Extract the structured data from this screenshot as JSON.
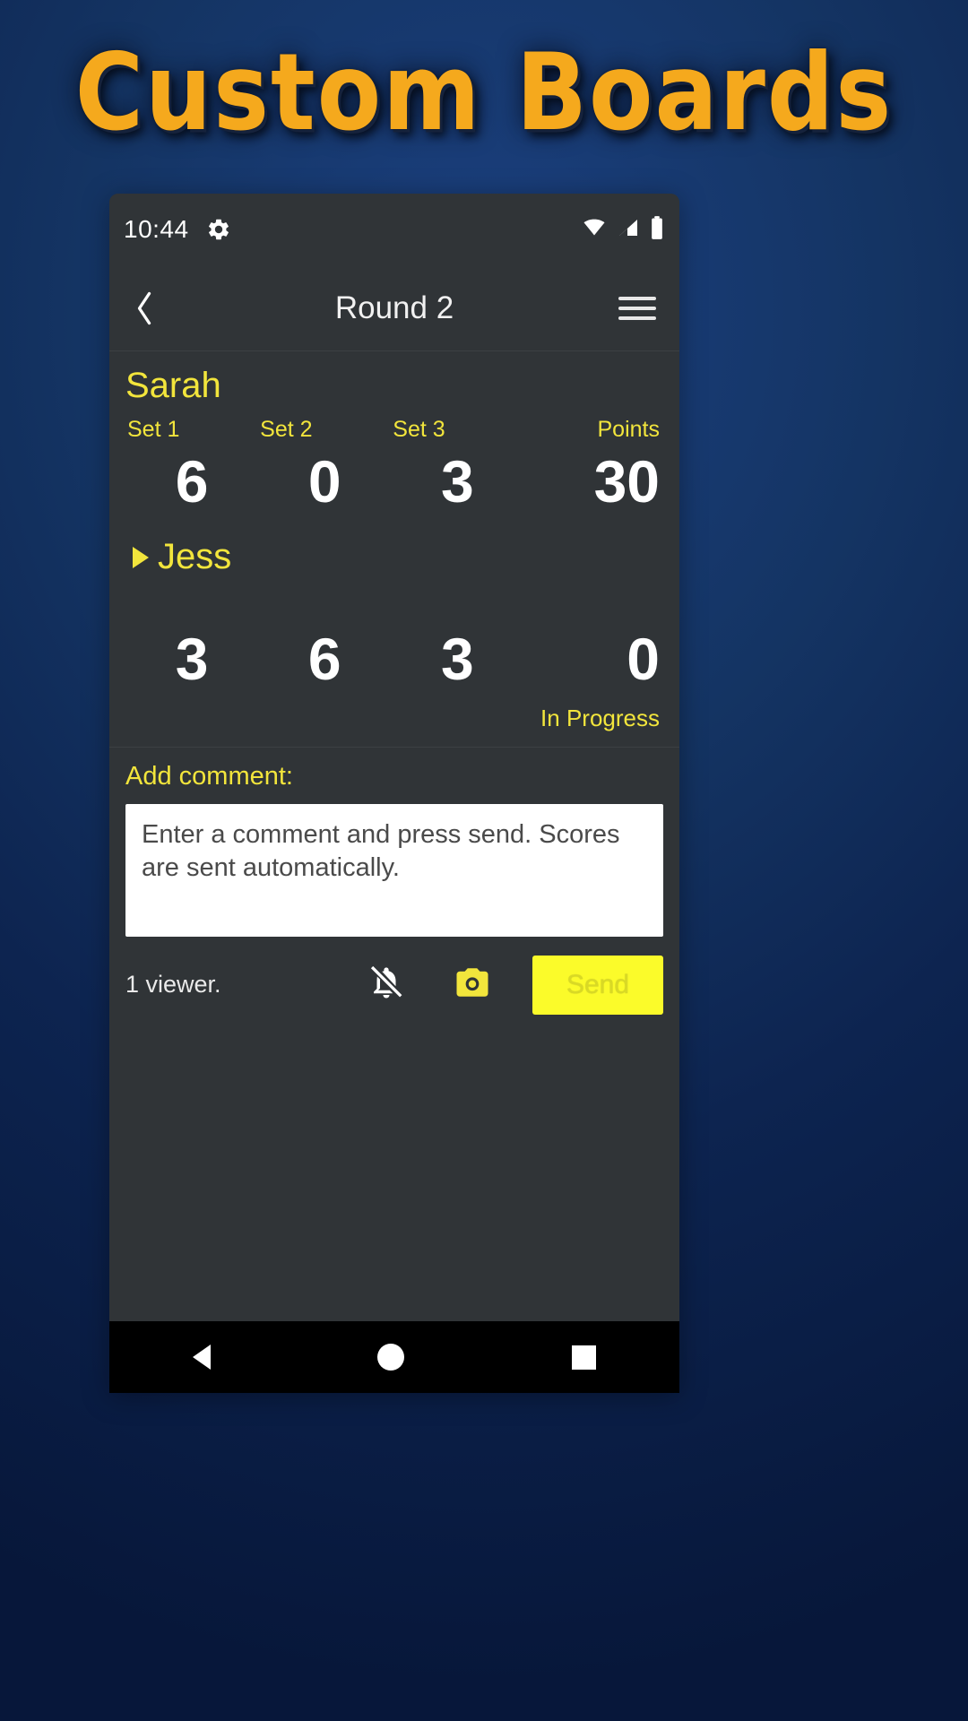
{
  "hero": {
    "title": "Custom Boards",
    "accent_color": "#f5a91d",
    "background_color": "#0d2450"
  },
  "phone": {
    "statusbar": {
      "time": "10:44",
      "gear_icon": "gear-icon",
      "wifi_icon": "wifi-icon",
      "signal_icon": "cellular-signal-icon",
      "battery_icon": "battery-full-icon"
    },
    "appbar": {
      "back_icon": "back-chevron-icon",
      "title": "Round 2",
      "menu_icon": "hamburger-menu-icon"
    },
    "scoreboard": {
      "accent_color": "#f2e53c",
      "headers": [
        "Set 1",
        "Set 2",
        "Set 3"
      ],
      "points_header": "Points",
      "players": [
        {
          "name": "Sarah",
          "serving": false,
          "sets": [
            "6",
            "0",
            "3"
          ],
          "points": "30"
        },
        {
          "name": "Jess",
          "serving": true,
          "sets": [
            "3",
            "6",
            "3"
          ],
          "points": "0"
        }
      ],
      "match_status": "In Progress"
    },
    "comment": {
      "label": "Add comment:",
      "value": "",
      "placeholder": "Enter a comment and press send. Scores are sent automatically."
    },
    "toolbar": {
      "viewers": "1 viewer.",
      "mute_icon": "bell-off-icon",
      "camera_icon": "camera-icon",
      "send_label": "Send",
      "send_color": "#fbfb2a"
    },
    "navbar": {
      "back_icon": "nav-back-triangle-icon",
      "home_icon": "nav-home-circle-icon",
      "recents_icon": "nav-recents-square-icon"
    }
  }
}
